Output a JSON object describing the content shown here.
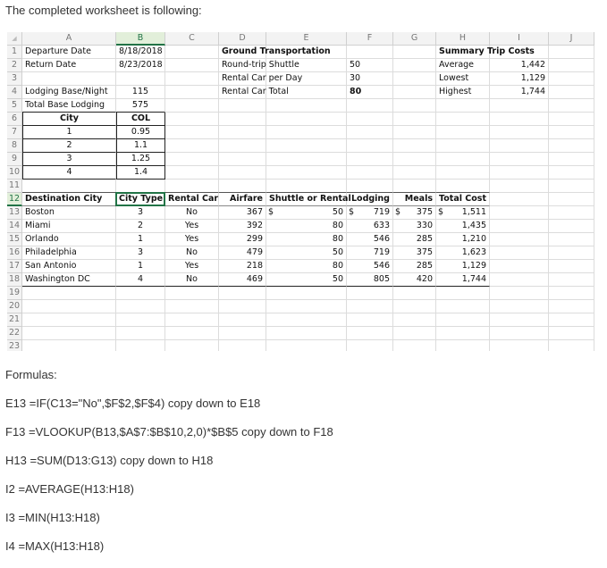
{
  "intro": "The completed worksheet is following:",
  "sheet": {
    "columns": [
      "A",
      "B",
      "C",
      "D",
      "E",
      "F",
      "G",
      "H",
      "I",
      "J"
    ],
    "selected_cell": "B12",
    "accent_color": "#217346",
    "rows": [
      [
        "Departure Date",
        "8/18/2018",
        "",
        "Ground Transportation",
        "",
        "",
        "",
        "Summary Trip Costs",
        "",
        ""
      ],
      [
        "Return Date",
        "8/23/2018",
        "",
        "Round-trip Shuttle",
        "",
        "50",
        "",
        "Average",
        "1,442",
        ""
      ],
      [
        "",
        "",
        "",
        "Rental Car per Day",
        "",
        "30",
        "",
        "Lowest",
        "1,129",
        ""
      ],
      [
        "Lodging Base/Night",
        "115",
        "",
        "Rental Car Total",
        "",
        "80",
        "",
        "Highest",
        "1,744",
        ""
      ],
      [
        "Total Base Lodging",
        "575",
        "",
        "",
        "",
        "",
        "",
        "",
        "",
        ""
      ],
      [
        "City",
        "COL",
        "",
        "",
        "",
        "",
        "",
        "",
        "",
        ""
      ],
      [
        "1",
        "0.95",
        "",
        "",
        "",
        "",
        "",
        "",
        "",
        ""
      ],
      [
        "2",
        "1.1",
        "",
        "",
        "",
        "",
        "",
        "",
        "",
        ""
      ],
      [
        "3",
        "1.25",
        "",
        "",
        "",
        "",
        "",
        "",
        "",
        ""
      ],
      [
        "4",
        "1.4",
        "",
        "",
        "",
        "",
        "",
        "",
        "",
        ""
      ],
      [
        "",
        "",
        "",
        "",
        "",
        "",
        "",
        "",
        "",
        ""
      ],
      [
        "Destination City",
        "City Type",
        "Rental Car",
        "Airfare",
        "Shuttle or Rental",
        "Lodging",
        "Meals",
        "Total Cost",
        "",
        ""
      ],
      [
        "Boston",
        "3",
        "No",
        "367",
        "$ 50",
        "$ 719",
        "$ 375",
        "$ 1,511",
        "",
        ""
      ],
      [
        "Miami",
        "2",
        "Yes",
        "392",
        "80",
        "633",
        "330",
        "1,435",
        "",
        ""
      ],
      [
        "Orlando",
        "1",
        "Yes",
        "299",
        "80",
        "546",
        "285",
        "1,210",
        "",
        ""
      ],
      [
        "Philadelphia",
        "3",
        "No",
        "479",
        "50",
        "719",
        "375",
        "1,623",
        "",
        ""
      ],
      [
        "San Antonio",
        "1",
        "Yes",
        "218",
        "80",
        "546",
        "285",
        "1,129",
        "",
        ""
      ],
      [
        "Washington DC",
        "4",
        "No",
        "469",
        "50",
        "805",
        "420",
        "1,744",
        "",
        ""
      ],
      [
        "",
        "",
        "",
        "",
        "",
        "",
        "",
        "",
        "",
        ""
      ],
      [
        "",
        "",
        "",
        "",
        "",
        "",
        "",
        "",
        "",
        ""
      ],
      [
        "",
        "",
        "",
        "",
        "",
        "",
        "",
        "",
        "",
        ""
      ],
      [
        "",
        "",
        "",
        "",
        "",
        "",
        "",
        "",
        "",
        ""
      ],
      [
        "",
        "",
        "",
        "",
        "",
        "",
        "",
        "",
        "",
        ""
      ]
    ]
  },
  "formulas_title": "Formulas:",
  "formulas": [
    "E13 =IF(C13=\"No\",$F$2,$F$4) copy down to E18",
    "F13 =VLOOKUP(B13,$A$7:$B$10,2,0)*$B$5 copy down to F18",
    "H13 =SUM(D13:G13) copy down to H18",
    "I2 =AVERAGE(H13:H18)",
    "I3 =MIN(H13:H18)",
    "I4 =MAX(H13:H18)"
  ]
}
